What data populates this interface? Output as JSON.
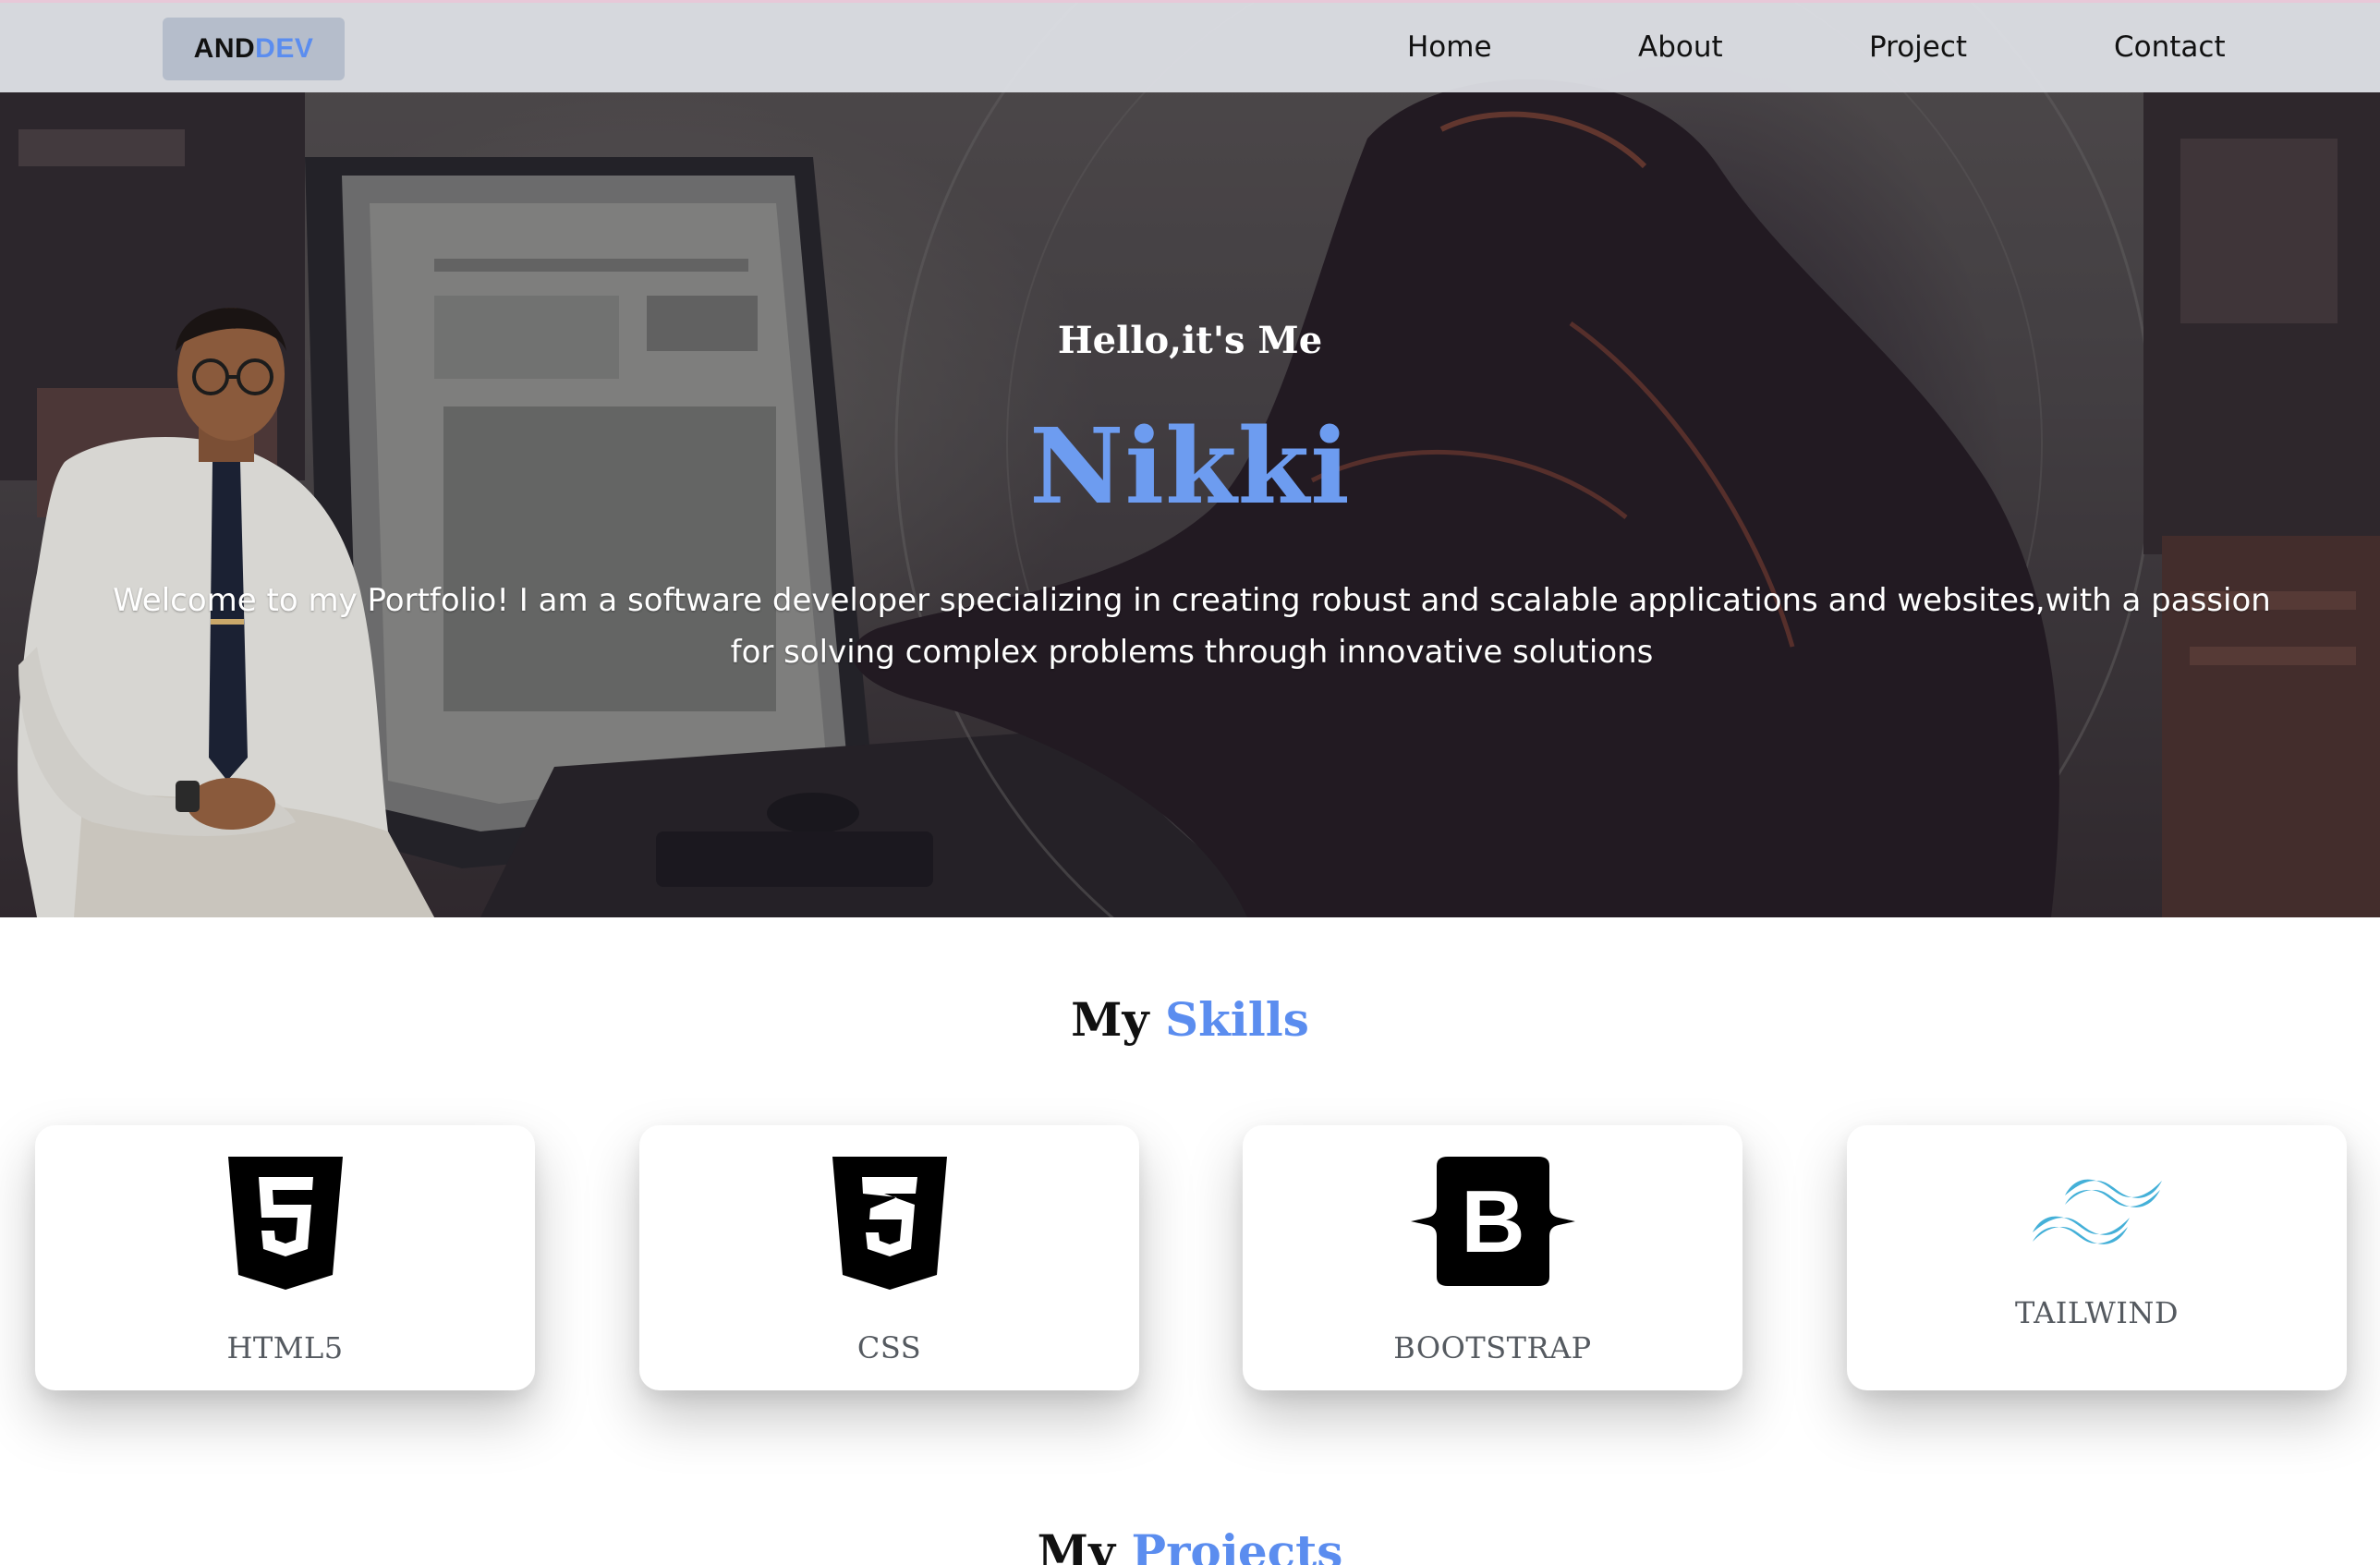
{
  "nav": {
    "logo_part1": "AND",
    "logo_part2": "DEV",
    "links": [
      {
        "label": "Home"
      },
      {
        "label": "About"
      },
      {
        "label": "Project"
      },
      {
        "label": "Contact"
      }
    ]
  },
  "hero": {
    "greeting": "Hello,it's Me",
    "name": "Nikki",
    "intro": "Welcome to my Portfolio! I am a software developer specializing in creating robust and scalable applications and websites,with a passion for solving complex problems through innovative solutions"
  },
  "skills": {
    "title_part1": "My",
    "title_part2": "Skills",
    "items": [
      {
        "label": "HTML5",
        "icon": "html5-icon"
      },
      {
        "label": "CSS",
        "icon": "css3-icon"
      },
      {
        "label": "BOOTSTRAP",
        "icon": "bootstrap-icon"
      },
      {
        "label": "TAILWIND",
        "icon": "tailwind-icon"
      }
    ]
  },
  "projects": {
    "title_part1": "My",
    "title_part2": "Projects"
  },
  "colors": {
    "accent": "#5b8def",
    "name": "#6d9cf0",
    "tailwind": "#44b0d8"
  }
}
